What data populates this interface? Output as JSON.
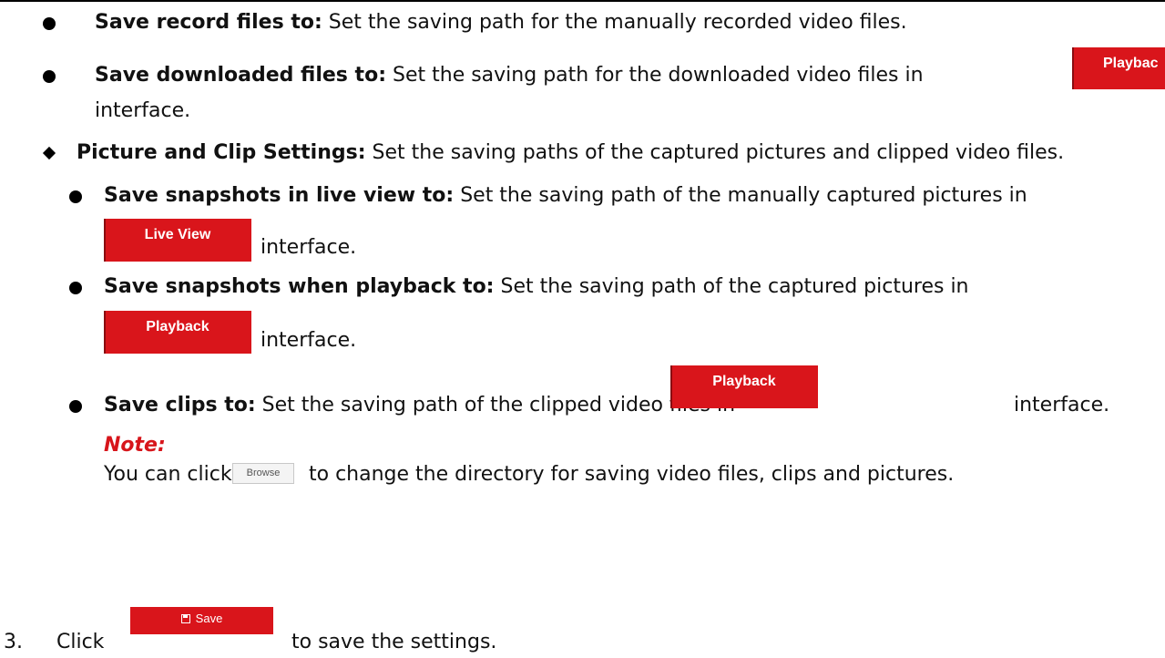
{
  "items": {
    "record": {
      "label": "Save record files to:",
      "text": "Set the saving path for the manually recorded video files."
    },
    "downloaded": {
      "label": "Save downloaded files to:",
      "text": "Set the saving path for the downloaded video files in",
      "button": "Playbac",
      "tail": "interface."
    },
    "picture_clip": {
      "label": "Picture and Clip Settings:",
      "text": "Set the saving paths of the captured pictures and clipped video files."
    },
    "live_snap": {
      "label": "Save snapshots in live view to:",
      "text": "Set the saving path of the manually captured pictures in",
      "button": "Live View",
      "tail": "interface."
    },
    "playback_snap": {
      "label": "Save snapshots when playback to:",
      "text": "Set the saving path of the captured pictures in",
      "button": "Playback",
      "tail": "interface."
    },
    "clips": {
      "label": "Save clips to:",
      "text": "Set the saving path of the clipped video files in",
      "button": "Playback",
      "tail": "interface."
    }
  },
  "note": {
    "title": "Note:",
    "before": "You can click",
    "button": "Browse",
    "after": "to change the directory for saving video files, clips and pictures."
  },
  "step3": {
    "number": "3.",
    "before": "Click",
    "button": "Save",
    "after": "to save the settings."
  },
  "colors": {
    "accent_red": "#d9151b",
    "note_red": "#d7151b"
  }
}
